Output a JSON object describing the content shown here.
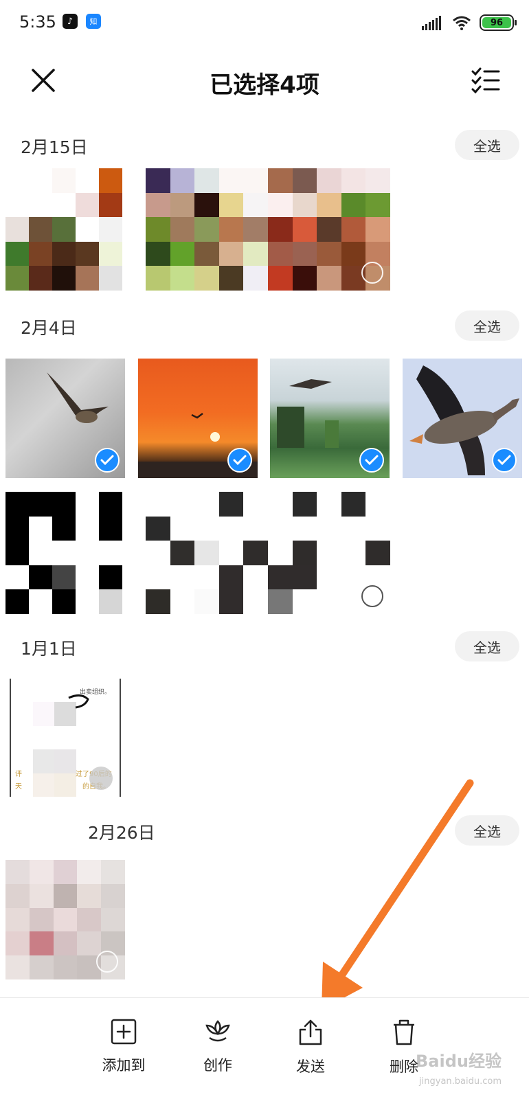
{
  "status_bar": {
    "time": "5:35",
    "tiktok_icon": "♪",
    "zhihu_icon": "知",
    "battery": "96"
  },
  "header": {
    "title": "已选择4项",
    "close_icon": "close-icon",
    "select_all_icon": "checklist-icon"
  },
  "sections": [
    {
      "date": "2月15日",
      "select_all": "全选"
    },
    {
      "date": "2月4日",
      "select_all": "全选"
    },
    {
      "date": "1月1日",
      "select_all": "全选"
    },
    {
      "date": "2月26日",
      "select_all": "全选"
    }
  ],
  "doc_thumb": {
    "top_text": "出卖组织。",
    "line1": "评",
    "line1b": "过了90后的",
    "line2": "天",
    "line2b": "的自我。"
  },
  "actions": [
    {
      "label": "添加到",
      "icon": "add-to-icon"
    },
    {
      "label": "创作",
      "icon": "create-icon"
    },
    {
      "label": "发送",
      "icon": "share-icon"
    },
    {
      "label": "删除",
      "icon": "delete-icon"
    }
  ],
  "watermark": {
    "text": "Baidu经验",
    "sub": "jingyan.baidu.com"
  },
  "colors": {
    "accent": "#1a8cff",
    "arrow": "#f47a2a",
    "battery": "#3cc24a"
  }
}
